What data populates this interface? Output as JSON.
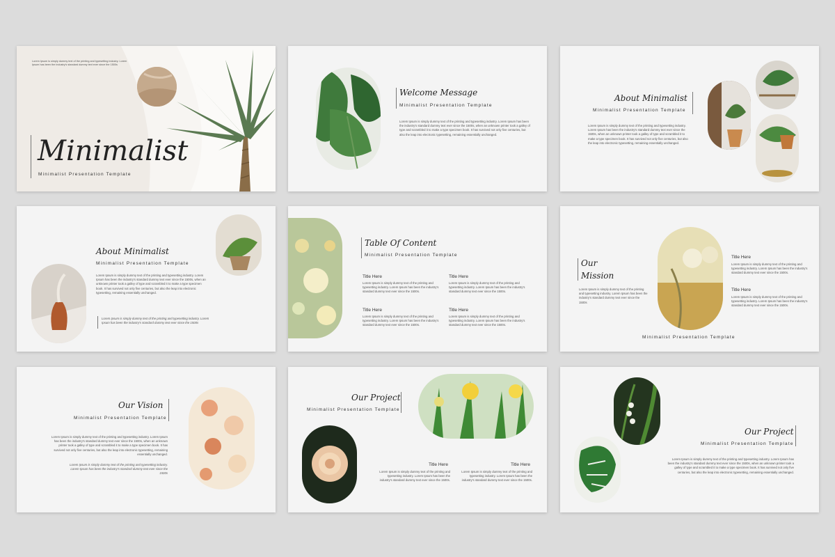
{
  "lorem_short": "Lorem Ipsum is simply dummy text of the printing and typesetting industry. Lorem Ipsum has been the industry's standard dummy text ever since the 1500s.",
  "lorem_long": "Lorem Ipsum is simply dummy text of the printing and typesetting industry. Lorem Ipsum has been the industry's standard dummy text ever since the 1500s, when an unknown printer took a galley of type and scrambled it to make a type specimen book. It has survived not only five centuries, but also the leap into electronic typesetting, remaining essentially unchanged.",
  "lorem_mid": "Lorem Ipsum is simply dummy text of the printing and typesetting industry. Lorem Ipsum has been the industry's standard dummy text ever since the 1500s, when an unknown printer took a galley of type and scrambled it to make a type specimen book. It has survived not only five centuries, but also the leap into electronic typesetting, remaining essentially unchanged.",
  "lorem_tiny": "Lorem Ipsum is simply dummy text of the printing and typesetting industry. Lorem Ipsum has been the industry's standard dummy text ever since the 1500s",
  "subtitle": "Minimalist Presentation Template",
  "item_title": "Title Here",
  "slides": {
    "cover": {
      "title": "Minimalist",
      "subtitle": "Minimalist Presentation Template",
      "top_text": "Lorem Ipsum is simply dummy text of the printing and typesetting industry. Lorem Ipsum has been the industry's standard dummy text ever since the 1500s"
    },
    "welcome": {
      "title": "Welcome Message"
    },
    "about1": {
      "title": "About Minimalist"
    },
    "about2": {
      "title": "About Minimalist",
      "quote": "Lorem Ipsum is simply dummy text of the printing and typesetting industry. Lorem Ipsum has been the industry's standard dummy text ever since the 1500s"
    },
    "toc": {
      "title": "Table Of Content"
    },
    "mission": {
      "title_line1": "Our",
      "title_line2": "Mission"
    },
    "vision": {
      "title": "Our Vision"
    },
    "project1": {
      "title": "Our Project"
    },
    "project2": {
      "title": "Our Project"
    }
  },
  "colors": {
    "background": "#dcdcdc",
    "slide": "#f4f4f4",
    "text": "#222222"
  }
}
